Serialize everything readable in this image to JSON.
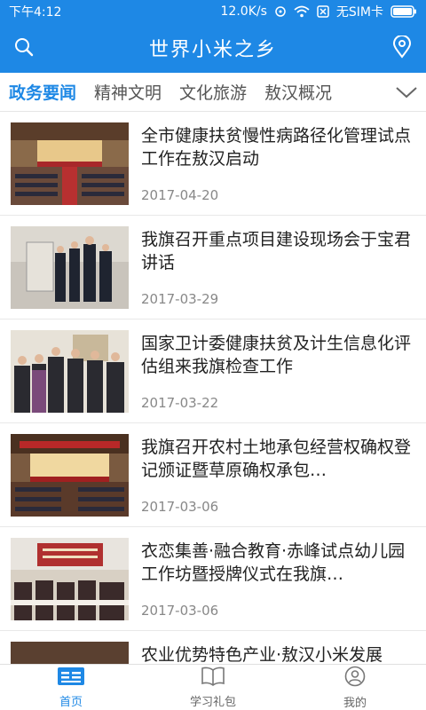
{
  "status_bar": {
    "time": "下午4:12",
    "network_speed": "12.0K/s",
    "sim_status": "无SIM卡"
  },
  "app_bar": {
    "title": "世界小米之乡",
    "left_icon": "search-icon",
    "right_icon": "location-pin-icon"
  },
  "tabs": [
    {
      "label": "政务要闻",
      "active": true
    },
    {
      "label": "精神文明",
      "active": false
    },
    {
      "label": "文化旅游",
      "active": false
    },
    {
      "label": "敖汉概况",
      "active": false
    }
  ],
  "news": [
    {
      "title": "全市健康扶贫慢性病路径化管理试点工作在敖汉启动",
      "date": "2017-04-20",
      "thumb": "meeting-hall"
    },
    {
      "title": "我旗召开重点项目建设现场会于宝君讲话",
      "date": "2017-03-29",
      "thumb": "outdoor-site"
    },
    {
      "title": "国家卫计委健康扶贫及计生信息化评估组来我旗检查工作",
      "date": "2017-03-22",
      "thumb": "group-visit"
    },
    {
      "title": "我旗召开农村土地承包经营权确权登记颁证暨草原确权承包…",
      "date": "2017-03-06",
      "thumb": "meeting-hall"
    },
    {
      "title": "衣恋集善·融合教育·赤峰试点幼儿园工作坊暨授牌仪式在我旗…",
      "date": "2017-03-06",
      "thumb": "conference-room"
    },
    {
      "title": "农业优势特色产业·敖汉小米发展",
      "date": "",
      "thumb": "meeting-hall"
    }
  ],
  "bottom_nav": [
    {
      "label": "首页",
      "icon": "home-news-icon",
      "active": true
    },
    {
      "label": "学习礼包",
      "icon": "book-icon",
      "active": false
    },
    {
      "label": "我的",
      "icon": "user-icon",
      "active": false
    }
  ],
  "colors": {
    "primary": "#1e88e5",
    "text": "#222222",
    "muted": "#888888"
  }
}
